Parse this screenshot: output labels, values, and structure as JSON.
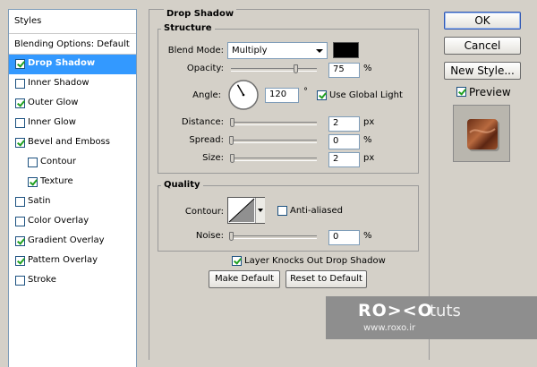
{
  "styles_panel": {
    "header": "Styles",
    "blending_options": "Blending Options: Default",
    "items": [
      {
        "label": "Drop Shadow",
        "checked": true,
        "selected": true,
        "sub": false
      },
      {
        "label": "Inner Shadow",
        "checked": false,
        "selected": false,
        "sub": false
      },
      {
        "label": "Outer Glow",
        "checked": true,
        "selected": false,
        "sub": false
      },
      {
        "label": "Inner Glow",
        "checked": false,
        "selected": false,
        "sub": false
      },
      {
        "label": "Bevel and Emboss",
        "checked": true,
        "selected": false,
        "sub": false
      },
      {
        "label": "Contour",
        "checked": false,
        "selected": false,
        "sub": true
      },
      {
        "label": "Texture",
        "checked": true,
        "selected": false,
        "sub": true
      },
      {
        "label": "Satin",
        "checked": false,
        "selected": false,
        "sub": false
      },
      {
        "label": "Color Overlay",
        "checked": false,
        "selected": false,
        "sub": false
      },
      {
        "label": "Gradient Overlay",
        "checked": true,
        "selected": false,
        "sub": false
      },
      {
        "label": "Pattern Overlay",
        "checked": true,
        "selected": false,
        "sub": false
      },
      {
        "label": "Stroke",
        "checked": false,
        "selected": false,
        "sub": false
      }
    ]
  },
  "drop_shadow": {
    "title": "Drop Shadow",
    "structure": {
      "title": "Structure",
      "blend_mode_label": "Blend Mode:",
      "blend_mode_value": "Multiply",
      "shadow_color": "#000000",
      "opacity_label": "Opacity:",
      "opacity_value": "75",
      "opacity_unit": "%",
      "opacity_fraction": 0.75,
      "angle_label": "Angle:",
      "angle_value": "120",
      "angle_unit": "°",
      "angle_degrees": 120,
      "use_global_light_label": "Use Global Light",
      "use_global_light": true,
      "distance_label": "Distance:",
      "distance_value": "2",
      "distance_unit": "px",
      "spread_label": "Spread:",
      "spread_value": "0",
      "spread_unit": "%",
      "size_label": "Size:",
      "size_value": "2",
      "size_unit": "px"
    },
    "quality": {
      "title": "Quality",
      "contour_label": "Contour:",
      "anti_aliased_label": "Anti-aliased",
      "anti_aliased": false,
      "noise_label": "Noise:",
      "noise_value": "0",
      "noise_unit": "%"
    },
    "knockout_label": "Layer Knocks Out Drop Shadow",
    "knockout": true,
    "make_default_label": "Make Default",
    "reset_default_label": "Reset to Default"
  },
  "buttons": {
    "ok": "OK",
    "cancel": "Cancel",
    "new_style": "New Style...",
    "preview_label": "Preview",
    "preview": true
  },
  "watermark": {
    "brand": "RO><O",
    "suffix": "tuts",
    "url": "www.roxo.ir"
  }
}
